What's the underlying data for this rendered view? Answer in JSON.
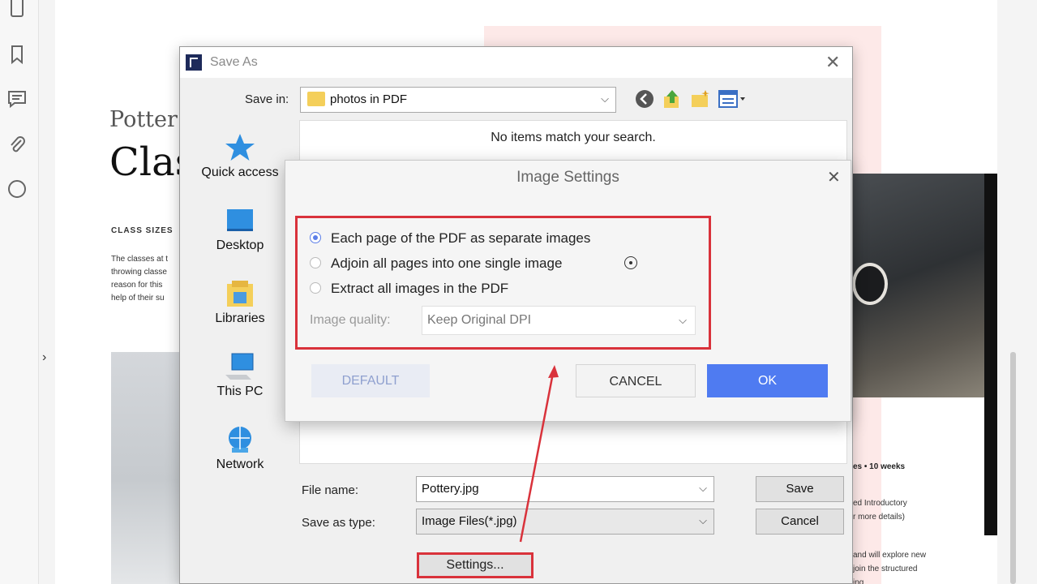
{
  "document": {
    "subtitle": "Potter",
    "title": "Clas",
    "section_label": "CLASS SIZES",
    "paragraph_lines": [
      "The classes at t",
      "throwing classe",
      "reason for this",
      "help of their su"
    ],
    "right_title": "es • 10 weeks",
    "right_lines": [
      "ed Introductory",
      "r more details)"
    ],
    "right_lines2": [
      "and will explore new",
      "join the structured",
      "ing"
    ]
  },
  "save_as": {
    "title": "Save As",
    "save_in_label": "Save in:",
    "save_in_value": "photos in PDF",
    "empty_message": "No items match your search.",
    "places": [
      {
        "label": "Quick access",
        "icon": "star-icon"
      },
      {
        "label": "Desktop",
        "icon": "desktop-icon"
      },
      {
        "label": "Libraries",
        "icon": "libraries-icon"
      },
      {
        "label": "This PC",
        "icon": "computer-icon"
      },
      {
        "label": "Network",
        "icon": "network-icon"
      }
    ],
    "file_name_label": "File name:",
    "file_name_value": "Pottery.jpg",
    "save_type_label": "Save as type:",
    "save_type_value": "Image Files(*.jpg)",
    "save_button": "Save",
    "cancel_button": "Cancel",
    "settings_button": "Settings..."
  },
  "image_settings": {
    "title": "Image Settings",
    "options": [
      {
        "label": "Each page of the PDF as separate images",
        "selected": true
      },
      {
        "label": "Adjoin all pages into one single image",
        "selected": false
      },
      {
        "label": "Extract all images in the PDF",
        "selected": false
      }
    ],
    "quality_label": "Image quality:",
    "quality_value": "Keep Original DPI",
    "default_button": "DEFAULT",
    "cancel_button": "CANCEL",
    "ok_button": "OK"
  },
  "colors": {
    "highlight_red": "#d9323b",
    "ok_blue": "#4f7bf1",
    "radio_blue": "#5b7ee8"
  }
}
